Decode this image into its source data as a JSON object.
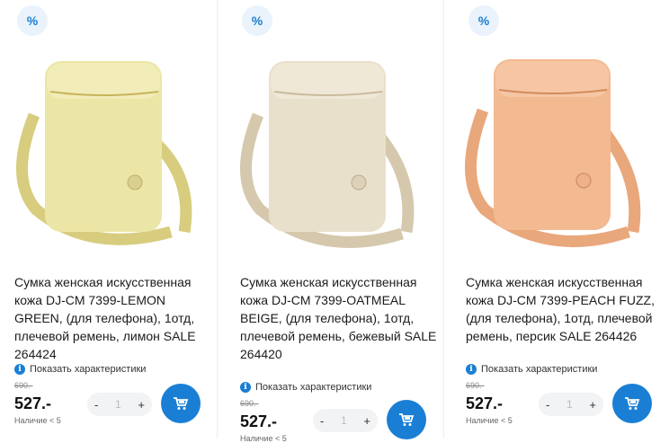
{
  "discount_badge": "%",
  "characteristics_label": "Показать характеристики",
  "info_glyph": "i",
  "minus": "-",
  "plus": "+",
  "products": [
    {
      "title": "Сумка женская искусственная кожа DJ-CM 7399-LEMON GREEN, (для телефона), 1отд, плечевой ремень, лимон SALE 264424",
      "old_price": "690.-",
      "price": "527.-",
      "stock": "Наличие < 5",
      "qty": "1",
      "color": "#ece6a6",
      "strap_color": "#d8cc7e"
    },
    {
      "title": "Сумка женская искусственная кожа DJ-CM 7399-OATMEAL BEIGE, (для телефона), 1отд, плечевой ремень, бежевый SALE 264420",
      "old_price": "690.-",
      "price": "527.-",
      "stock": "Наличие < 5",
      "qty": "1",
      "color": "#e9e0cc",
      "strap_color": "#d5c8ad"
    },
    {
      "title": "Сумка женская искусственная кожа DJ-CM 7399-PEACH FUZZ, (для телефона), 1отд, плечевой ремень, персик SALE 264426",
      "old_price": "690.-",
      "price": "527.-",
      "stock": "Наличие < 5",
      "qty": "1",
      "color": "#f3b991",
      "strap_color": "#e9a77c"
    }
  ]
}
